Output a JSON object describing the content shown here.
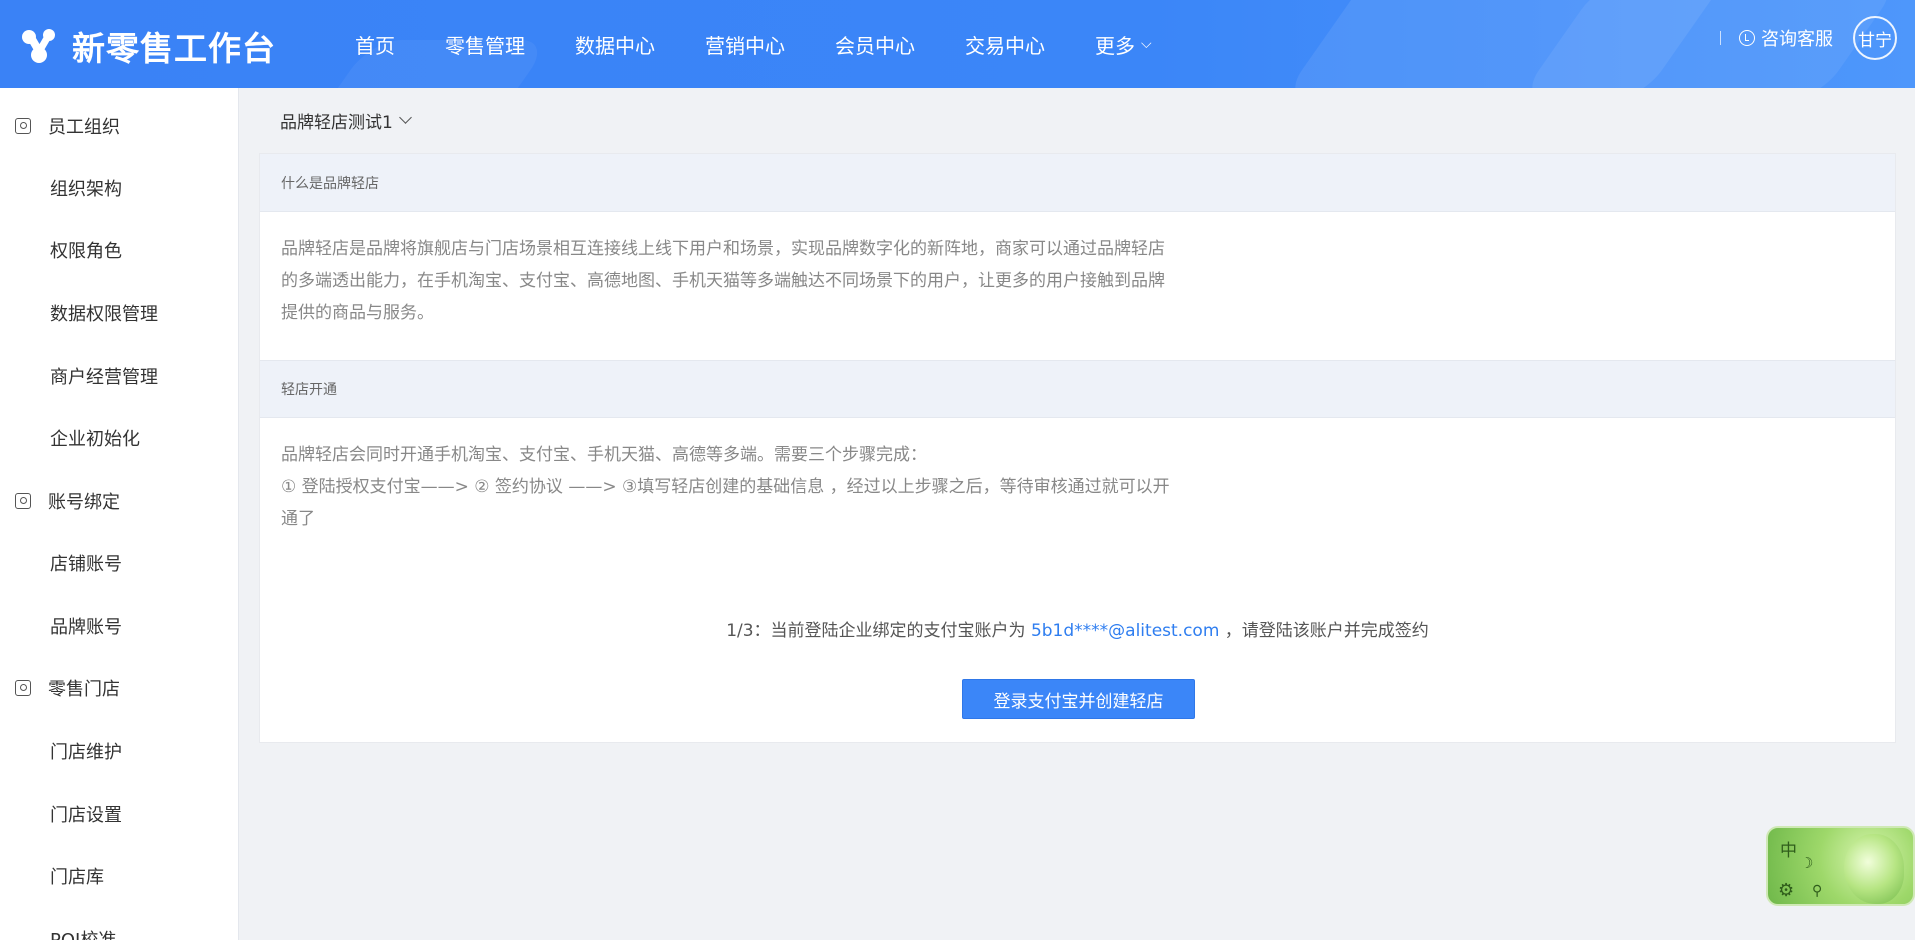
{
  "header": {
    "app_title": "新零售工作台",
    "nav": [
      "首页",
      "零售管理",
      "数据中心",
      "营销中心",
      "会员中心",
      "交易中心",
      "更多"
    ],
    "service_label": "咨询客服",
    "avatar_text": "甘宁",
    "colors": {
      "primary": "#3b86f8"
    }
  },
  "sidebar": {
    "groups": [
      {
        "label": "员工组织",
        "icon": "contact-card-icon",
        "items": [
          "组织架构",
          "权限角色",
          "数据权限管理",
          "商户经营管理",
          "企业初始化"
        ]
      },
      {
        "label": "账号绑定",
        "icon": "account-bind-icon",
        "items": [
          "店铺账号",
          "品牌账号"
        ]
      },
      {
        "label": "零售门店",
        "icon": "store-icon",
        "items": [
          "门店维护",
          "门店设置",
          "门店库",
          "POI校准"
        ]
      }
    ]
  },
  "main": {
    "store_select": "品牌轻店测试1",
    "sections": [
      {
        "title": "什么是品牌轻店",
        "lines": [
          "品牌轻店是品牌将旗舰店与门店场景相互连接线上线下用户和场景，实现品牌数字化的新阵地，商家可以通过品牌轻店",
          "的多端透出能力，在手机淘宝、支付宝、高德地图、手机天猫等多端触达不同场景下的用户，让更多的用户接触到品牌",
          "提供的商品与服务。"
        ]
      },
      {
        "title": "轻店开通",
        "lines": [
          "品牌轻店会同时开通手机淘宝、支付宝、手机天猫、高德等多端。需要三个步骤完成：",
          "① 登陆授权支付宝——> ② 签约协议 ——> ③填写轻店创建的基础信息 ，经过以上步骤之后，等待审核通过就可以开",
          "通了"
        ]
      }
    ],
    "step": {
      "prefix": "1/3：当前登陆企业绑定的支付宝账户为 ",
      "account": "5b1d****@alitest.com",
      "suffix": " ，请登陆该账户并完成签约"
    },
    "button_label": "登录支付宝并创建轻店"
  },
  "ime": {
    "mode": "中",
    "icons": [
      "moon-icon",
      "gear-icon",
      "pin-icon"
    ]
  }
}
